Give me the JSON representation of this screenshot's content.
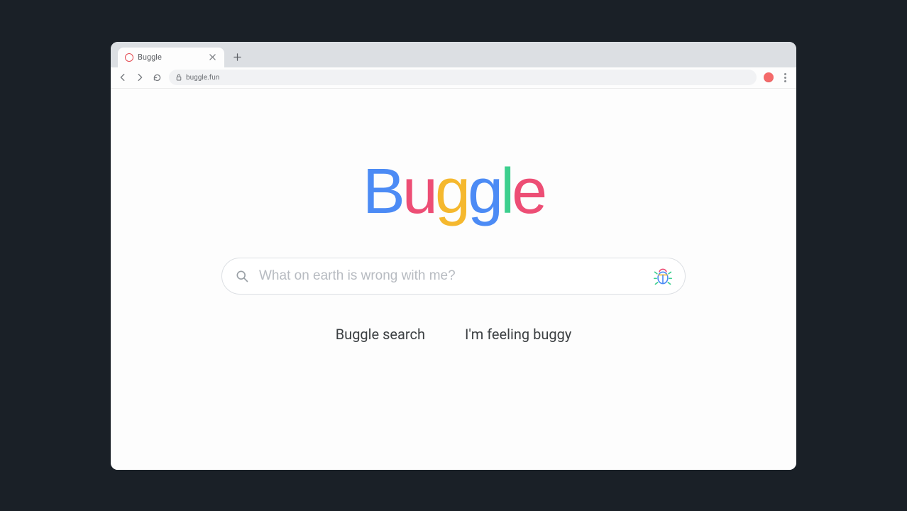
{
  "tab": {
    "title": "Buggle"
  },
  "address": {
    "url": "buggle.fun"
  },
  "logo": {
    "letters": [
      "B",
      "u",
      "g",
      "g",
      "l",
      "e"
    ]
  },
  "search": {
    "placeholder": "What on earth is wrong with me?"
  },
  "buttons": {
    "search": "Buggle search",
    "lucky": "I'm feeling buggy"
  }
}
